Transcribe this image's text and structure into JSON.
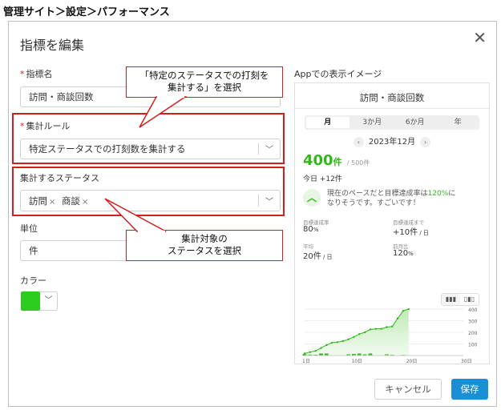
{
  "breadcrumb": "管理サイト＞設定＞パフォーマンス",
  "dialog": {
    "title": "指標を編集",
    "close_icon": "close-icon"
  },
  "form": {
    "name_label": "指標名",
    "name_value": "訪問・商談回数",
    "rule_label": "集計ルール",
    "rule_value": "特定ステータスでの打刻数を集計する",
    "status_label": "集計するステータス",
    "status_tags": [
      "訪問",
      "商談"
    ],
    "unit_label": "単位",
    "unit_value": "件",
    "color_label": "カラー",
    "color_value": "#2ecc1f"
  },
  "callouts": {
    "rule": [
      "「特定のステータスでの打刻を",
      "集計する」を選択"
    ],
    "status": [
      "集計対象の",
      "ステータスを選択"
    ]
  },
  "preview": {
    "label": "Appでの表示イメージ",
    "title": "訪問・商談回数",
    "tabs": [
      "月",
      "3か月",
      "6か月",
      "年"
    ],
    "active_tab": "月",
    "month": "2023年12月",
    "value": "400",
    "value_unit": "件",
    "target": "/ 500件",
    "today_prefix": "今日",
    "today_value": "+12件",
    "pace_text_1": "現在のペースだと目標達成率は",
    "pace_pct": "120%",
    "pace_text_2": "に",
    "pace_text_3": "なりそうです。すごいです！",
    "stats": [
      {
        "label": "目標達成率",
        "value": "80",
        "unit": "%"
      },
      {
        "label": "目標達成まで",
        "value": "+10件",
        "unit": " / 日"
      },
      {
        "label": "平均",
        "value": "20件",
        "unit": " / 日"
      },
      {
        "label": "前月比",
        "value": "120",
        "unit": "%"
      }
    ]
  },
  "chart_data": {
    "type": "area",
    "x_ticks": [
      "1日",
      "10日",
      "20日",
      "30日"
    ],
    "y_ticks": [
      "400",
      "300",
      "200",
      "100"
    ],
    "ylim": [
      0,
      400
    ],
    "xlim": [
      1,
      30
    ],
    "cumulative": [
      [
        1,
        18
      ],
      [
        2,
        30
      ],
      [
        3,
        40
      ],
      [
        4,
        65
      ],
      [
        5,
        90
      ],
      [
        6,
        110
      ],
      [
        7,
        115
      ],
      [
        8,
        125
      ],
      [
        9,
        140
      ],
      [
        10,
        160
      ],
      [
        11,
        185
      ],
      [
        12,
        200
      ],
      [
        13,
        225
      ],
      [
        14,
        230
      ],
      [
        15,
        230
      ],
      [
        16,
        245
      ],
      [
        17,
        250
      ],
      [
        18,
        320
      ],
      [
        19,
        385
      ],
      [
        20,
        400
      ]
    ],
    "daily": [
      [
        1,
        18
      ],
      [
        2,
        12
      ],
      [
        3,
        10
      ],
      [
        4,
        25
      ],
      [
        5,
        25
      ],
      [
        6,
        0
      ],
      [
        7,
        0
      ],
      [
        8,
        0
      ],
      [
        9,
        15
      ],
      [
        10,
        20
      ],
      [
        11,
        25
      ],
      [
        12,
        15
      ],
      [
        13,
        25
      ],
      [
        14,
        0
      ],
      [
        15,
        0
      ],
      [
        16,
        15
      ],
      [
        17,
        10
      ],
      [
        18,
        0
      ],
      [
        19,
        8
      ],
      [
        20,
        5
      ]
    ],
    "color": "#2fb818"
  },
  "buttons": {
    "cancel": "キャンセル",
    "save": "保存"
  }
}
